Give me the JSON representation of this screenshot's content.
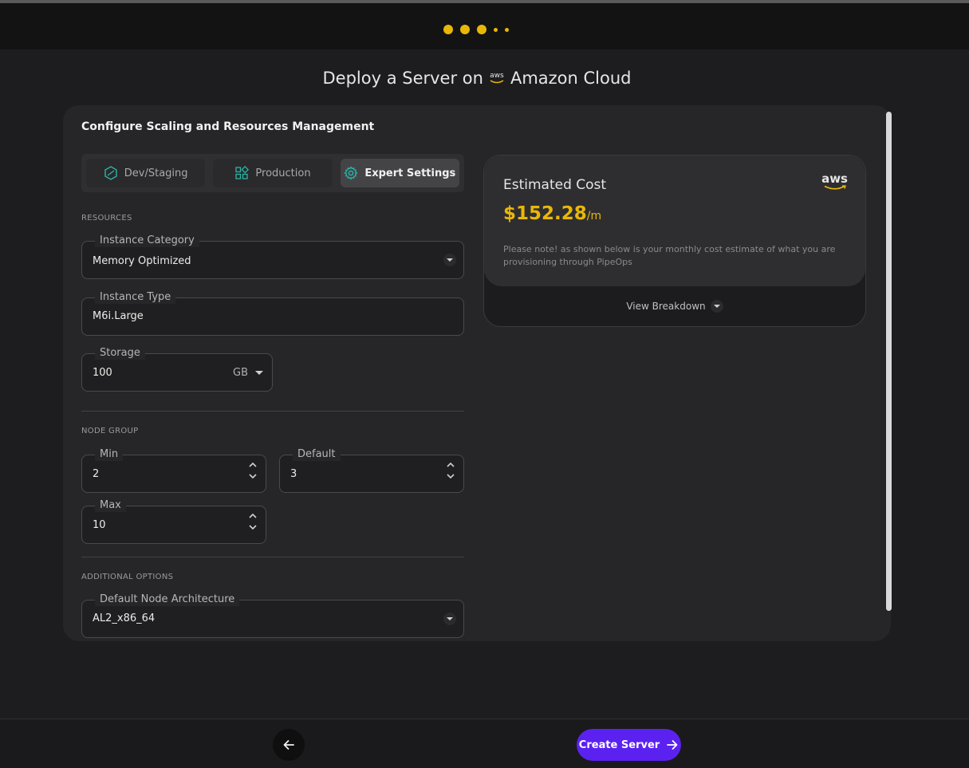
{
  "header": {
    "progress_steps_total": 5,
    "progress_steps_done": 3
  },
  "page": {
    "title_prefix": "Deploy a Server on",
    "title_logo": "aws",
    "title_suffix": "Amazon Cloud"
  },
  "card": {
    "heading": "Configure Scaling and Resources Management",
    "tabs": [
      {
        "label": "Dev/Staging",
        "icon": "hexagon-icon",
        "active": false
      },
      {
        "label": "Production",
        "icon": "grid-icon",
        "active": false
      },
      {
        "label": "Expert Settings",
        "icon": "gear-icon",
        "active": true
      }
    ],
    "resources": {
      "section_label": "RESOURCES",
      "instance_category": {
        "label": "Instance Category",
        "value": "Memory Optimized"
      },
      "instance_type": {
        "label": "Instance Type",
        "value": "M6i.Large"
      },
      "storage": {
        "label": "Storage",
        "value": "100",
        "unit": "GB"
      }
    },
    "node_group": {
      "section_label": "NODE GROUP",
      "min": {
        "label": "Min",
        "value": "2"
      },
      "default": {
        "label": "Default",
        "value": "3"
      },
      "max": {
        "label": "Max",
        "value": "10"
      }
    },
    "additional": {
      "section_label": "ADDITIONAL OPTIONS",
      "node_architecture": {
        "label": "Default Node Architecture",
        "value": "AL2_x86_64"
      }
    }
  },
  "cost": {
    "title": "Estimated Cost",
    "price": "$152.28",
    "period": "/m",
    "note": "Please note! as shown below is your monthly cost estimate of what you are provisioning through PipeOps",
    "logo": "aws",
    "breakdown_label": "View Breakdown"
  },
  "footer": {
    "create_label": "Create Server"
  },
  "colors": {
    "accent": "#e9b708",
    "primary": "#5b21f0",
    "teal_icon": "#2bb5a8"
  }
}
